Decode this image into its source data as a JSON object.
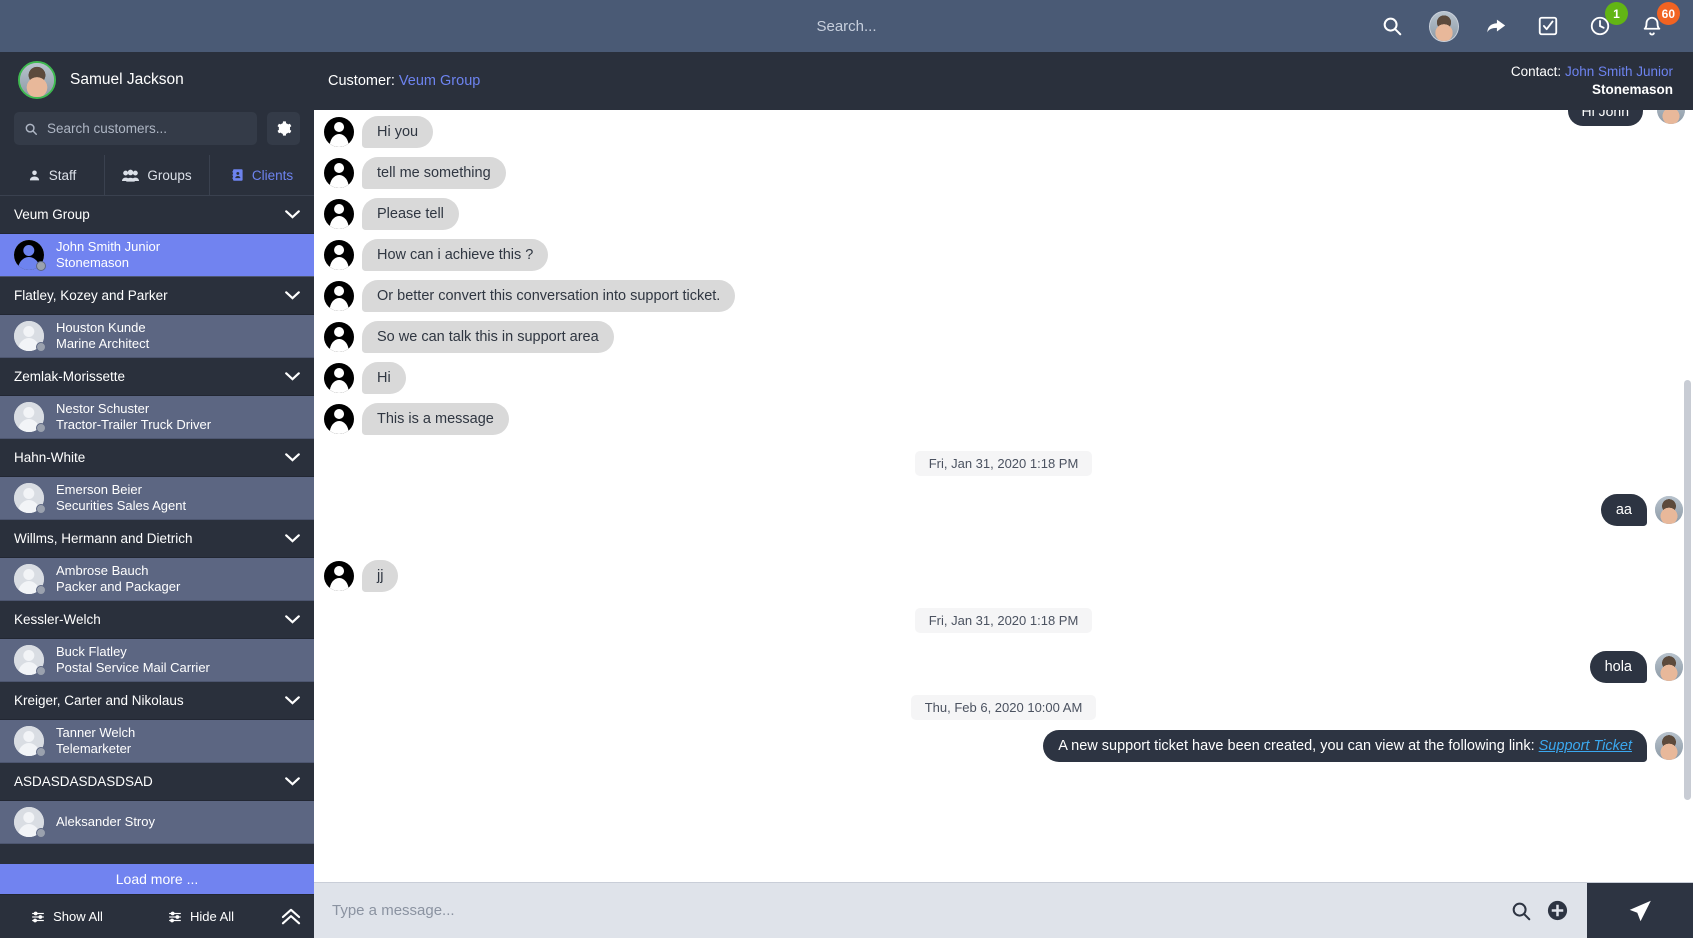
{
  "topbar": {
    "search_placeholder": "Search...",
    "icons": [
      {
        "name": "search-icon",
        "label": "Search"
      },
      {
        "name": "user-avatar-icon",
        "label": "Profile"
      },
      {
        "name": "share-icon",
        "label": "Share"
      },
      {
        "name": "tasks-icon",
        "label": "Tasks"
      }
    ],
    "clock_badge": "1",
    "bell_badge": "60",
    "badge_green": "#62b514",
    "badge_orange": "#f26322",
    "bg_color": "#4a5a75"
  },
  "sidebar": {
    "user_name": "Samuel Jackson",
    "search_placeholder": "Search customers...",
    "gear_icon": "gear-icon",
    "tabs": [
      {
        "label": "Staff",
        "icon": "user-icon",
        "active": false
      },
      {
        "label": "Groups",
        "icon": "users-icon",
        "active": false
      },
      {
        "label": "Clients",
        "icon": "address-book-icon",
        "active": true
      }
    ],
    "groups": [
      {
        "name": "Veum Group",
        "contacts": [
          {
            "name": "John Smith Junior",
            "role": "Stonemason",
            "selected": true
          }
        ]
      },
      {
        "name": "Flatley, Kozey and Parker",
        "contacts": [
          {
            "name": "Houston Kunde",
            "role": "Marine Architect",
            "selected": false
          }
        ]
      },
      {
        "name": "Zemlak-Morissette",
        "contacts": [
          {
            "name": "Nestor Schuster",
            "role": "Tractor-Trailer Truck Driver",
            "selected": false
          }
        ]
      },
      {
        "name": "Hahn-White",
        "contacts": [
          {
            "name": "Emerson Beier",
            "role": "Securities Sales Agent",
            "selected": false
          }
        ]
      },
      {
        "name": "Willms, Hermann and Dietrich",
        "contacts": [
          {
            "name": "Ambrose Bauch",
            "role": "Packer and Packager",
            "selected": false
          }
        ]
      },
      {
        "name": "Kessler-Welch",
        "contacts": [
          {
            "name": "Buck Flatley",
            "role": "Postal Service Mail Carrier",
            "selected": false
          }
        ]
      },
      {
        "name": "Kreiger, Carter and Nikolaus",
        "contacts": [
          {
            "name": "Tanner Welch",
            "role": "Telemarketer",
            "selected": false
          }
        ]
      },
      {
        "name": "ASDASDASDASDSAD",
        "contacts": [
          {
            "name": "Aleksander Stroy",
            "role": "",
            "selected": false
          }
        ]
      }
    ],
    "load_more": "Load more ...",
    "footer": {
      "show_all": "Show All",
      "hide_all": "Hide All",
      "collapse_icon": "chevron-double-up-icon"
    },
    "selected_color": "#7183f0"
  },
  "chat": {
    "header": {
      "customer_label": "Customer:",
      "customer_name": "Veum Group",
      "contact_label": "Contact:",
      "contact_name": "John Smith Junior",
      "contact_role": "Stonemason"
    },
    "peek_message": "Hi John",
    "messages": [
      {
        "type": "in",
        "text": "Hi you"
      },
      {
        "type": "in",
        "text": "tell me something"
      },
      {
        "type": "in",
        "text": "Please tell"
      },
      {
        "type": "in",
        "text": "How can i achieve this ?"
      },
      {
        "type": "in",
        "text": "Or better convert this conversation into support ticket."
      },
      {
        "type": "in",
        "text": "So we can talk this in support area"
      },
      {
        "type": "in",
        "text": "Hi"
      },
      {
        "type": "in",
        "text": "This is a message"
      },
      {
        "type": "timestamp",
        "text": "Fri, Jan 31, 2020 1:18 PM"
      },
      {
        "type": "out",
        "text": "aa"
      },
      {
        "type": "in",
        "text": "jj"
      },
      {
        "type": "timestamp",
        "text": "Fri, Jan 31, 2020 1:18 PM"
      },
      {
        "type": "out",
        "text": "hola"
      },
      {
        "type": "timestamp",
        "text": "Thu, Feb 6, 2020 10:00 AM"
      },
      {
        "type": "out",
        "text": "A new support ticket have been created, you can view at the following link: ",
        "link": "Support Ticket"
      }
    ]
  },
  "composer": {
    "placeholder": "Type a message...",
    "search_icon": "search-icon",
    "add_icon": "plus-circle-icon",
    "send_icon": "send-icon"
  }
}
